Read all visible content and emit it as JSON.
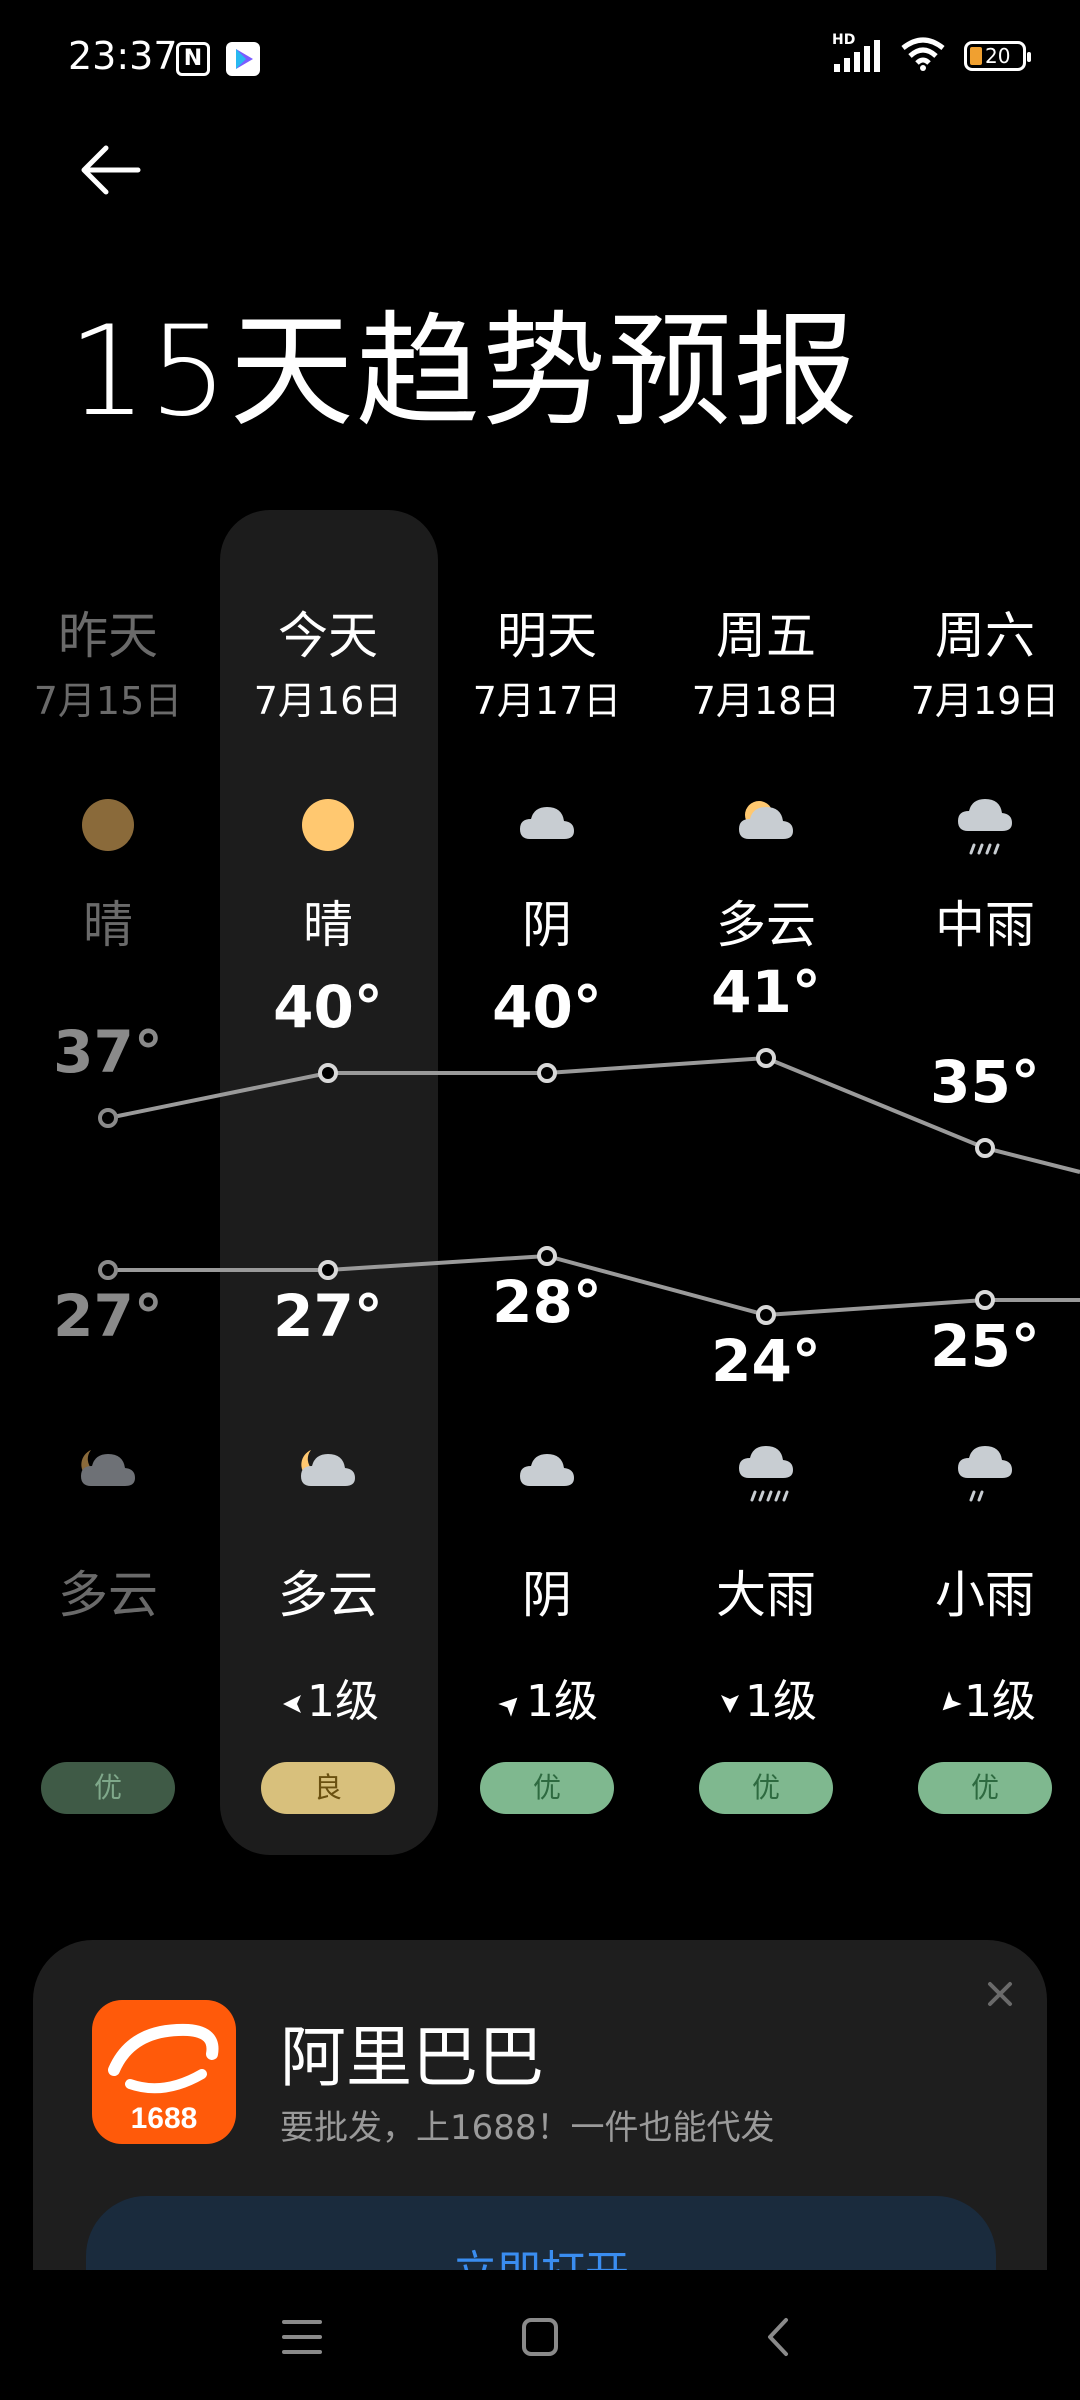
{
  "status_bar": {
    "time": "23:37",
    "network": "HD",
    "battery": "20",
    "icons": [
      "nfc-icon",
      "play-store-icon",
      "signal-icon",
      "wifi-icon",
      "battery-icon"
    ]
  },
  "header": {
    "back_icon": "arrow-left-icon",
    "title": "15天趋势预报"
  },
  "forecast": {
    "days": [
      {
        "name": "昨天",
        "date": "7月15日",
        "day_icon": "sun-icon",
        "day_text": "晴",
        "high": "37°",
        "low": "27°",
        "night_icon": "moon-cloud-icon",
        "night_text": "多云",
        "wind": "",
        "wind_dir": "",
        "aqi": "优"
      },
      {
        "name": "今天",
        "date": "7月16日",
        "day_icon": "sun-icon",
        "day_text": "晴",
        "high": "40°",
        "low": "27°",
        "night_icon": "moon-cloud-icon",
        "night_text": "多云",
        "wind": "1级",
        "wind_dir": "west-arrow-icon",
        "aqi": "良"
      },
      {
        "name": "明天",
        "date": "7月17日",
        "day_icon": "cloud-icon",
        "day_text": "阴",
        "high": "40°",
        "low": "28°",
        "night_icon": "cloud-icon",
        "night_text": "阴",
        "wind": "1级",
        "wind_dir": "northeast-arrow-icon",
        "aqi": "优"
      },
      {
        "name": "周五",
        "date": "7月18日",
        "day_icon": "sun-cloud-icon",
        "day_text": "多云",
        "high": "41°",
        "low": "24°",
        "night_icon": "heavy-rain-icon",
        "night_text": "大雨",
        "wind": "1级",
        "wind_dir": "south-arrow-icon",
        "aqi": "优"
      },
      {
        "name": "周六",
        "date": "7月19日",
        "day_icon": "rain-icon",
        "day_text": "中雨",
        "high": "35°",
        "low": "25°",
        "night_icon": "light-rain-icon",
        "night_text": "小雨",
        "wind": "1级",
        "wind_dir": "southwest-arrow-icon",
        "aqi": "优"
      }
    ],
    "colors": {
      "good": "#7fb88f",
      "moderate": "#d8c07c",
      "line": "#9a9a9a",
      "sun": "#ffc870",
      "cloud": "#c8cdd2"
    }
  },
  "ad": {
    "app_name": "阿里巴巴",
    "logo_text": "1688",
    "description": "要批发，上1688！一件也能代发",
    "button_label": "立即打开",
    "close_icon": "close-icon"
  },
  "nav_bar": {
    "icons": [
      "menu-icon",
      "home-icon",
      "back-icon"
    ]
  }
}
